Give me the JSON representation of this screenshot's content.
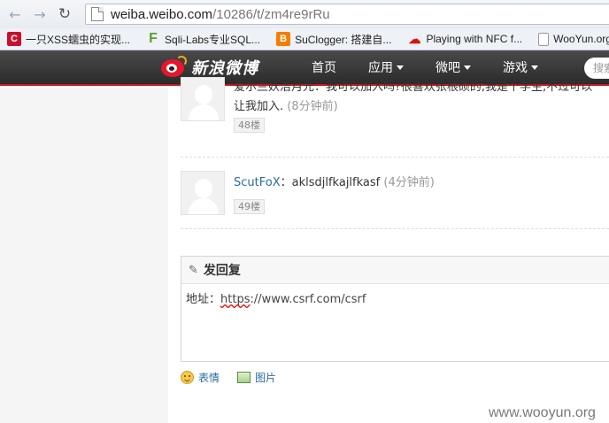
{
  "browser": {
    "back_icon": "back-arrow-icon",
    "forward_icon": "forward-arrow-icon",
    "reload_icon": "reload-icon",
    "url_host": "weiba.weibo.com",
    "url_path": "/10286/t/zm4re9rRu"
  },
  "bookmarks": [
    {
      "label": "一只XSS蠕虫的实现...",
      "icon": "red-c-icon"
    },
    {
      "label": "Sqli-Labs专业SQL...",
      "icon": "green-f-icon"
    },
    {
      "label": "SuClogger: 搭建自...",
      "icon": "blogger-icon"
    },
    {
      "label": "Playing with NFC f...",
      "icon": "cloud-icon"
    },
    {
      "label": "WooYun.org",
      "icon": "page-icon"
    }
  ],
  "weibo_nav": {
    "logo_text": "新浪微博",
    "items": [
      {
        "label": "首页",
        "dropdown": false
      },
      {
        "label": "应用",
        "dropdown": true
      },
      {
        "label": "微吧",
        "dropdown": true
      },
      {
        "label": "游戏",
        "dropdown": true
      }
    ],
    "search_placeholder": "搜索"
  },
  "posts": [
    {
      "author": "",
      "line1": "爱尔兰妖洁月光：我可以加入吗?很喜欢张根硕的,我是个学生,不过可以",
      "line2": "让我加入.",
      "time": "(8分钟前)",
      "floor": "48楼"
    },
    {
      "author": "ScutFoX",
      "separator": "：",
      "text": "aklsdjlfkajlfkasf",
      "time": "(4分钟前)",
      "floor": "49楼"
    }
  ],
  "reply": {
    "title": "发回复",
    "label": "地址：",
    "url_underlined": "https",
    "url_rest": "://www.csrf.com/csrf"
  },
  "tools": {
    "emoji_label": "表情",
    "picture_label": "图片"
  },
  "watermark": "www.wooyun.org"
}
